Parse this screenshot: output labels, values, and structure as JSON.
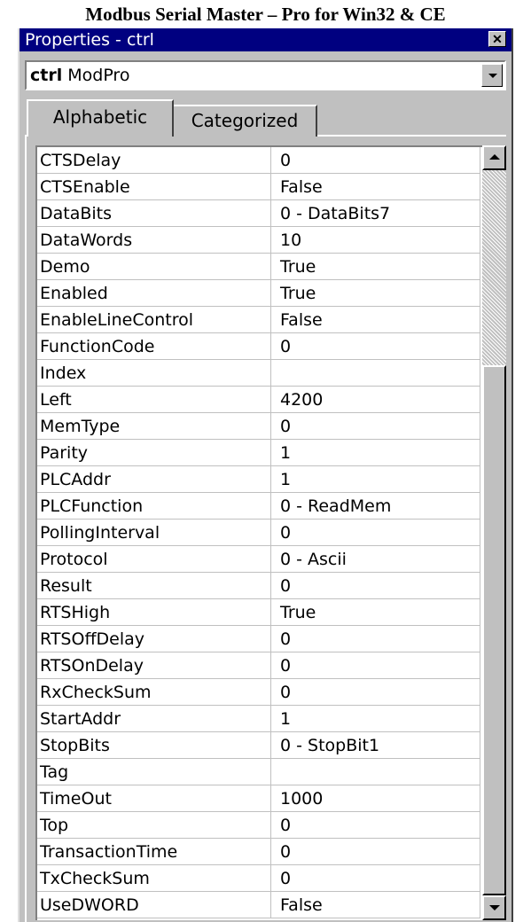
{
  "document": {
    "heading": "Modbus Serial Master – Pro for Win32 & CE"
  },
  "window": {
    "title": "Properties - ctrl",
    "close_glyph": "✕",
    "close_icon": "close-icon"
  },
  "object_selector": {
    "name": "ctrl",
    "type": "ModPro",
    "dropdown_icon": "chevron-down-icon"
  },
  "tabs": [
    {
      "label": "Alphabetic",
      "active": true
    },
    {
      "label": "Categorized",
      "active": false
    }
  ],
  "scrollbar": {
    "up_icon": "arrow-up-icon",
    "down_icon": "arrow-down-icon"
  },
  "properties": [
    {
      "name": "CTSDelay",
      "value": "0"
    },
    {
      "name": "CTSEnable",
      "value": "False"
    },
    {
      "name": "DataBits",
      "value": "0 - DataBits7"
    },
    {
      "name": "DataWords",
      "value": "10"
    },
    {
      "name": "Demo",
      "value": "True"
    },
    {
      "name": "Enabled",
      "value": "True"
    },
    {
      "name": "EnableLineControl",
      "value": "False"
    },
    {
      "name": "FunctionCode",
      "value": "0"
    },
    {
      "name": "Index",
      "value": ""
    },
    {
      "name": "Left",
      "value": "4200"
    },
    {
      "name": "MemType",
      "value": "0"
    },
    {
      "name": "Parity",
      "value": "1"
    },
    {
      "name": "PLCAddr",
      "value": "1"
    },
    {
      "name": "PLCFunction",
      "value": "0 - ReadMem"
    },
    {
      "name": "PollingInterval",
      "value": "0"
    },
    {
      "name": "Protocol",
      "value": "0 - Ascii"
    },
    {
      "name": "Result",
      "value": "0"
    },
    {
      "name": "RTSHigh",
      "value": "True"
    },
    {
      "name": "RTSOffDelay",
      "value": "0"
    },
    {
      "name": "RTSOnDelay",
      "value": "0"
    },
    {
      "name": "RxCheckSum",
      "value": "0"
    },
    {
      "name": "StartAddr",
      "value": "1"
    },
    {
      "name": "StopBits",
      "value": "0 - StopBit1"
    },
    {
      "name": "Tag",
      "value": ""
    },
    {
      "name": "TimeOut",
      "value": "1000"
    },
    {
      "name": "Top",
      "value": "0"
    },
    {
      "name": "TransactionTime",
      "value": "0"
    },
    {
      "name": "TxCheckSum",
      "value": "0"
    },
    {
      "name": "UseDWORD",
      "value": "False"
    }
  ]
}
